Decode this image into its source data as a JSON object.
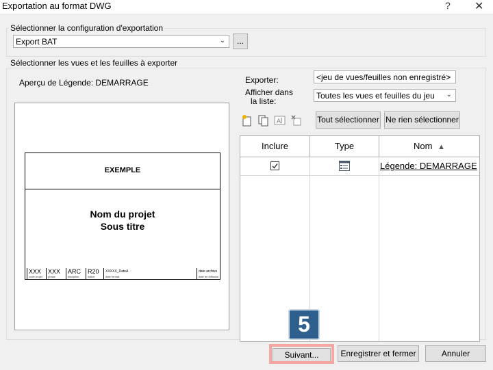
{
  "window": {
    "title": "Exportation au format DWG",
    "help_glyph": "?",
    "close_glyph": "✕"
  },
  "export_config": {
    "group_label": "Sélectionner la configuration d'exportation",
    "selected": "Export BAT",
    "browse_label": "..."
  },
  "views": {
    "group_label": "Sélectionner les vues et les feuilles à exporter",
    "preview_title": "Aperçu de Légende: DEMARRAGE",
    "exporter_label": "Exporter:",
    "exporter_value": "<jeu de vues/feuilles non enregistré>",
    "afficher_label_1": "Afficher dans",
    "afficher_label_2": "la liste:",
    "afficher_value": "Toutes les vues et feuilles du jeu",
    "select_all_label": "Tout sélectionner",
    "select_none_label": "Ne rien sélectionner",
    "columns": [
      "Inclure",
      "Type",
      "Nom"
    ],
    "sort_indicator": "▲",
    "rows": [
      {
        "included": true,
        "type_icon": "legend-view-icon",
        "name": "Légende: DEMARRAGE"
      }
    ]
  },
  "preview_sheet": {
    "heading": "EXEMPLE",
    "project_name": "Nom du projet",
    "subtitle": "Sous titre",
    "footer": [
      {
        "big": "XXX",
        "small": "code projet"
      },
      {
        "big": "XXX",
        "small": "phase"
      },
      {
        "big": "ARC",
        "small": "discipline"
      },
      {
        "big": "R20",
        "small": "indice"
      },
      {
        "big": "XXXXX_DateA",
        "small": "date format"
      },
      {
        "big": "date archive",
        "small": "date de diffusion"
      }
    ]
  },
  "footer_buttons": {
    "next": "Suivant...",
    "save_close": "Enregistrer et fermer",
    "cancel": "Annuler"
  },
  "callout": {
    "step_number": "5",
    "badge_color": "#2f5f8c",
    "highlight_color": "#f4a7a0"
  },
  "icons": [
    "new-set-icon",
    "duplicate-icon",
    "rename-icon",
    "delete-icon",
    "checkbox-checked-icon",
    "legend-view-icon",
    "chevron-down-icon"
  ]
}
